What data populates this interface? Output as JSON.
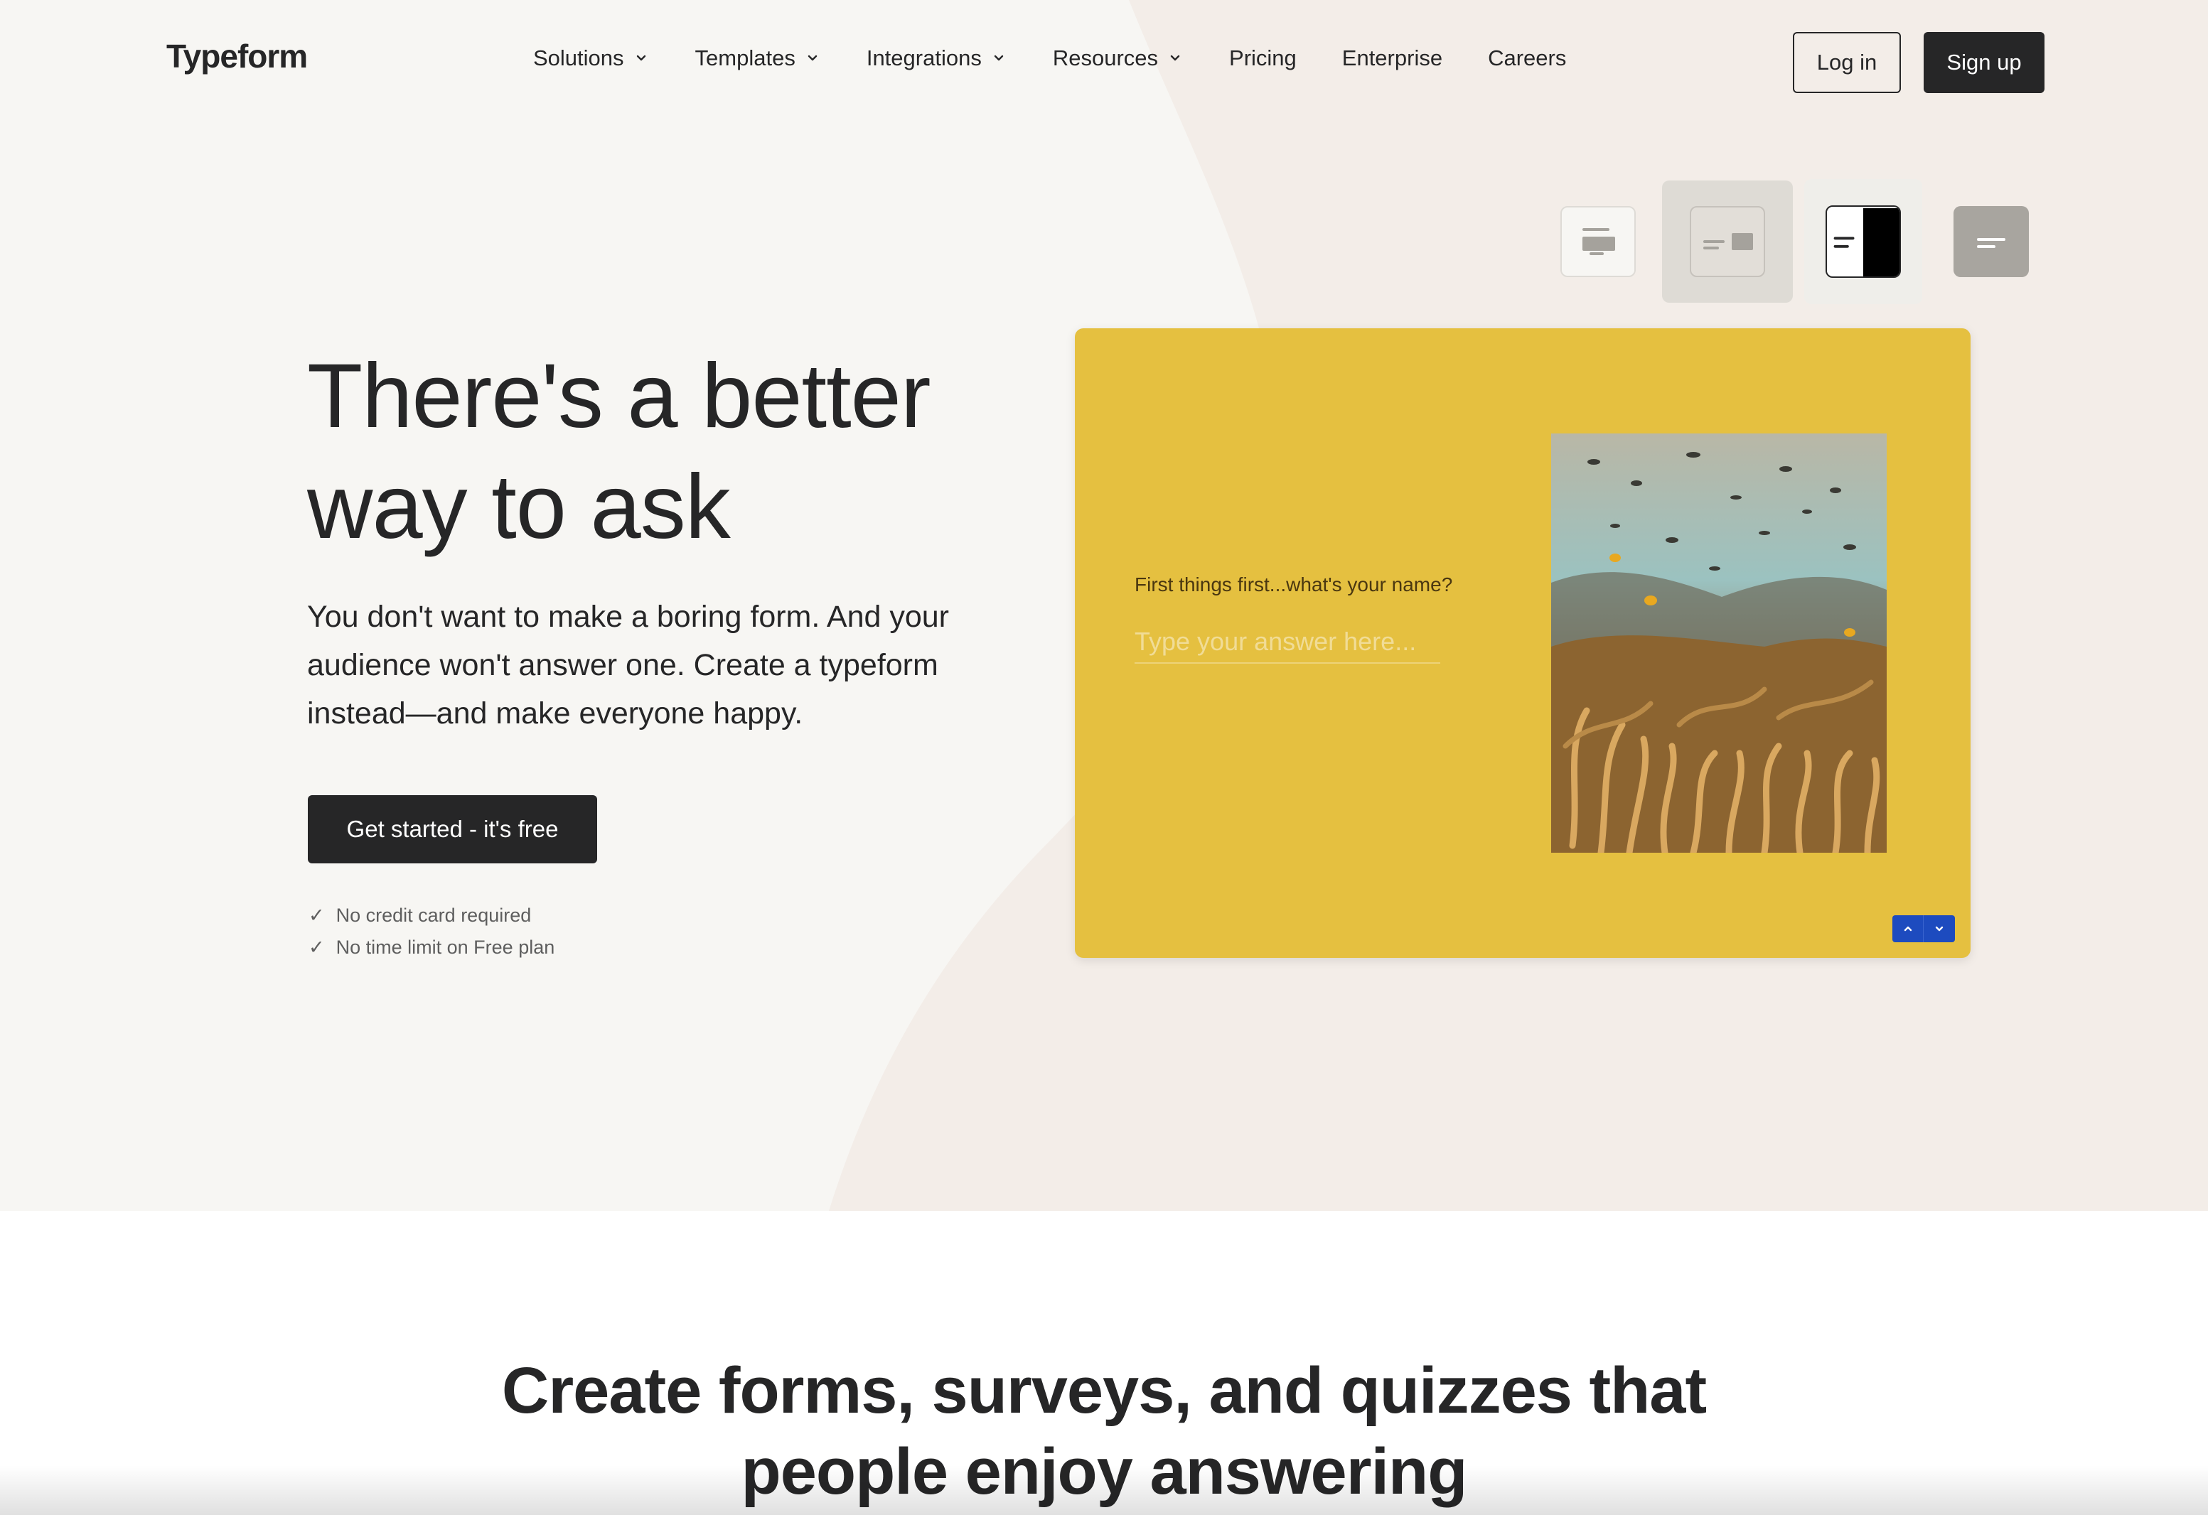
{
  "nav": {
    "logo": "Typeform",
    "links": [
      {
        "label": "Solutions",
        "dropdown": true
      },
      {
        "label": "Templates",
        "dropdown": true
      },
      {
        "label": "Integrations",
        "dropdown": true
      },
      {
        "label": "Resources",
        "dropdown": true
      },
      {
        "label": "Pricing",
        "dropdown": false
      },
      {
        "label": "Enterprise",
        "dropdown": false
      },
      {
        "label": "Careers",
        "dropdown": false
      }
    ],
    "login_label": "Log in",
    "signup_label": "Sign up"
  },
  "hero": {
    "headline_line1": "There's a better",
    "headline_line2": "way to ask",
    "subtext": "You don't want to make a boring form. And your audience won't answer one. Create a typeform instead—and make everyone happy.",
    "cta_label": "Get started - it's free",
    "checks": [
      "No credit card required",
      "No time limit on Free plan"
    ]
  },
  "layout_options": [
    "layout-stack-icon",
    "layout-split-icon",
    "layout-split-dark-icon",
    "layout-wallpaper-icon"
  ],
  "form_preview": {
    "question": "First things first...what's your name?",
    "placeholder": "Type your answer here...",
    "background_color": "#e5c040",
    "nav_color": "#1d4bbf"
  },
  "section2": {
    "title_line1": "Create forms, surveys, and quizzes that",
    "title_line2": "people enjoy answering"
  },
  "colors": {
    "ink": "#262627",
    "hero_bg": "#f7f6f3",
    "blob": "#f3ede8"
  }
}
